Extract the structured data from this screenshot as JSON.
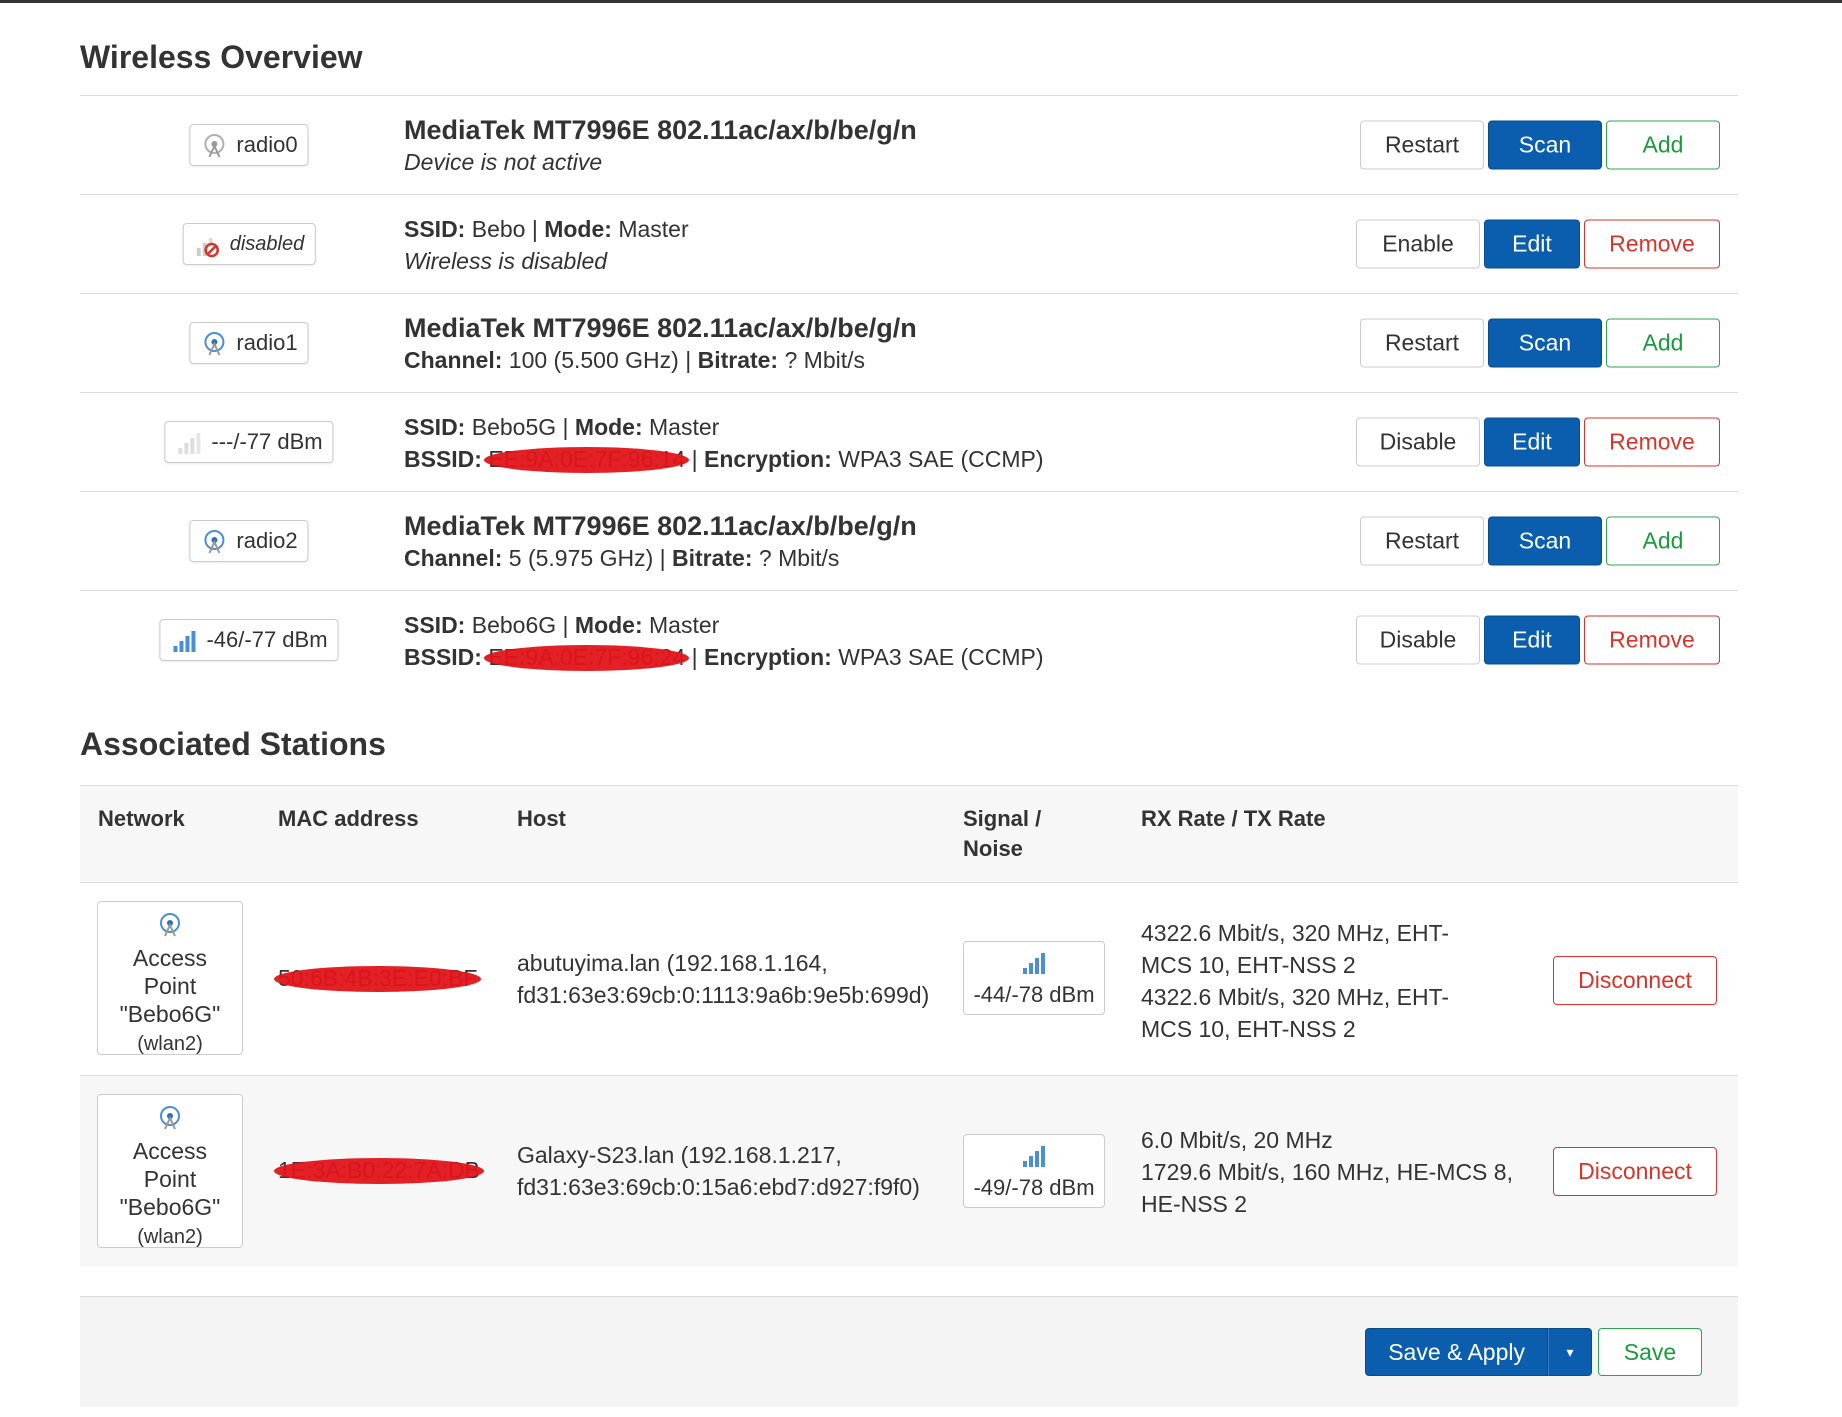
{
  "overview": {
    "title": "Wireless Overview",
    "rows": [
      {
        "badge": "radio0",
        "title": "MediaTek MT7996E 802.11ac/ax/b/be/g/n",
        "subtitle": "Device is not active",
        "buttons": [
          "Restart",
          "Scan",
          "Add"
        ]
      },
      {
        "badge": "disabled",
        "ssid_label": "SSID:",
        "ssid": "Bebo",
        "mode_label": "Mode:",
        "mode": "Master",
        "status": "Wireless is disabled",
        "buttons": [
          "Enable",
          "Edit",
          "Remove"
        ]
      },
      {
        "badge": "radio1",
        "title": "MediaTek MT7996E 802.11ac/ax/b/be/g/n",
        "channel_label": "Channel:",
        "channel": "100 (5.500 GHz)",
        "bitrate_label": "Bitrate:",
        "bitrate": "? Mbit/s",
        "buttons": [
          "Restart",
          "Scan",
          "Add"
        ]
      },
      {
        "badge": "---/-77 dBm",
        "ssid_label": "SSID:",
        "ssid": "Bebo5G",
        "mode_label": "Mode:",
        "mode": "Master",
        "bssid_label": "BSSID:",
        "bssid": "EE:9A:0E:7F:96:14",
        "enc_label": "Encryption:",
        "encryption": "WPA3 SAE (CCMP)",
        "buttons": [
          "Disable",
          "Edit",
          "Remove"
        ]
      },
      {
        "badge": "radio2",
        "title": "MediaTek MT7996E 802.11ac/ax/b/be/g/n",
        "channel_label": "Channel:",
        "channel": "5 (5.975 GHz)",
        "bitrate_label": "Bitrate:",
        "bitrate": "? Mbit/s",
        "buttons": [
          "Restart",
          "Scan",
          "Add"
        ]
      },
      {
        "badge": "-46/-77 dBm",
        "ssid_label": "SSID:",
        "ssid": "Bebo6G",
        "mode_label": "Mode:",
        "mode": "Master",
        "bssid_label": "BSSID:",
        "bssid": "EE:9A:0E:7F:96:24",
        "enc_label": "Encryption:",
        "encryption": "WPA3 SAE (CCMP)",
        "buttons": [
          "Disable",
          "Edit",
          "Remove"
        ]
      }
    ]
  },
  "stations": {
    "title": "Associated Stations",
    "headers": [
      "Network",
      "MAC address",
      "Host",
      "Signal /",
      "Noise",
      "RX Rate / TX Rate"
    ],
    "rows": [
      {
        "net_line1": "Access",
        "net_line2": "Point",
        "net_line3": "\"Bebo6G\"",
        "net_iface": "(wlan2)",
        "mac": "50:6B:4B:3E:E0:BF",
        "host_line1": "abutuyima.lan (192.168.1.164,",
        "host_line2": "fd31:63e3:69cb:0:1113:9a6b:9e5b:699d)",
        "signal": "-44/-78 dBm",
        "rate_lines": [
          "4322.6 Mbit/s, 320 MHz, EHT-",
          "MCS 10, EHT-NSS 2",
          "4322.6 Mbit/s, 320 MHz, EHT-",
          "MCS 10, EHT-NSS 2"
        ],
        "action": "Disconnect"
      },
      {
        "net_line1": "Access",
        "net_line2": "Point",
        "net_line3": "\"Bebo6G\"",
        "net_iface": "(wlan2)",
        "mac": "1E:3A:B0:22:7A:DB",
        "host_line1": "Galaxy-S23.lan (192.168.1.217,",
        "host_line2": "fd31:63e3:69cb:0:15a6:ebd7:d927:f9f0)",
        "signal": "-49/-78 dBm",
        "rate_lines": [
          "6.0 Mbit/s, 20 MHz",
          "1729.6 Mbit/s, 160 MHz, HE-MCS 8,",
          "HE-NSS 2"
        ],
        "action": "Disconnect"
      }
    ]
  },
  "footer": {
    "save_apply": "Save & Apply",
    "caret": "▾",
    "save": "Save"
  },
  "colors": {
    "primary": "#0a5ead",
    "positive": "#1c9a3e",
    "negative": "#d9342b",
    "redaction": "#e3141b"
  }
}
